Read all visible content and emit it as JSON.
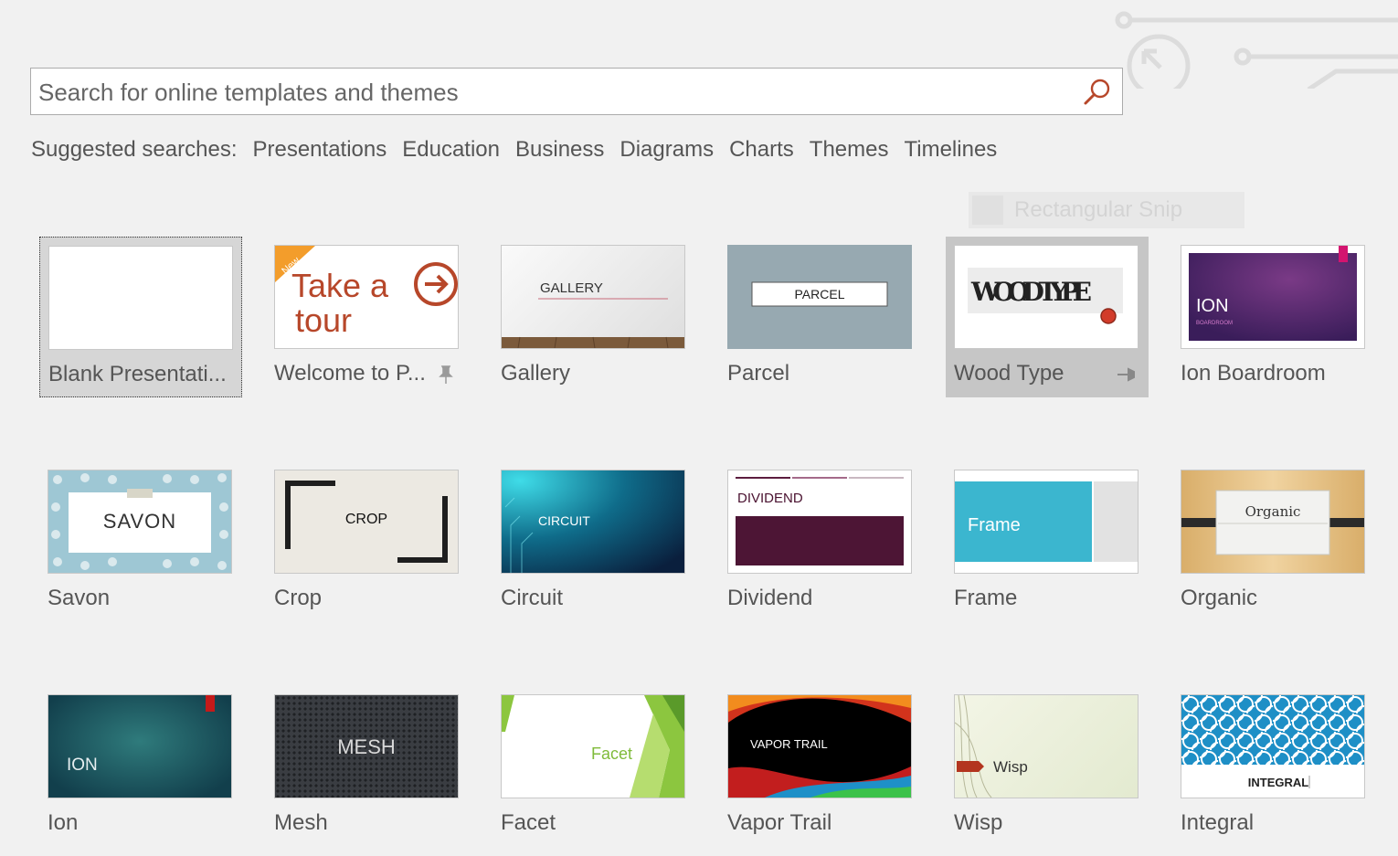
{
  "search": {
    "placeholder": "Search for online templates and themes",
    "value": ""
  },
  "suggested": {
    "label": "Suggested searches:",
    "links": [
      "Presentations",
      "Education",
      "Business",
      "Diagrams",
      "Charts",
      "Themes",
      "Timelines"
    ]
  },
  "overlay": {
    "snip_label": "Rectangular Snip"
  },
  "templates": [
    {
      "name": "Blank Presentati...",
      "thumb_text": ""
    },
    {
      "name": "Welcome to P...",
      "thumb_text": "Take a tour",
      "badge": "New",
      "pin": "pin-icon"
    },
    {
      "name": "Gallery",
      "thumb_text": "GALLERY"
    },
    {
      "name": "Parcel",
      "thumb_text": "PARCEL"
    },
    {
      "name": "Wood Type",
      "thumb_text": "WOOD TYPE",
      "pin": "pinned-icon"
    },
    {
      "name": "Ion Boardroom",
      "thumb_text": "ION",
      "thumb_subtext": "BOARDROOM"
    },
    {
      "name": "Savon",
      "thumb_text": "SAVON"
    },
    {
      "name": "Crop",
      "thumb_text": "CROP"
    },
    {
      "name": "Circuit",
      "thumb_text": "CIRCUIT"
    },
    {
      "name": "Dividend",
      "thumb_text": "DIVIDEND"
    },
    {
      "name": "Frame",
      "thumb_text": "Frame"
    },
    {
      "name": "Organic",
      "thumb_text": "Organic"
    },
    {
      "name": "Ion",
      "thumb_text": "ION"
    },
    {
      "name": "Mesh",
      "thumb_text": "MESH"
    },
    {
      "name": "Facet",
      "thumb_text": "Facet"
    },
    {
      "name": "Vapor Trail",
      "thumb_text": "VAPOR TRAIL"
    },
    {
      "name": "Wisp",
      "thumb_text": "Wisp"
    },
    {
      "name": "Integral",
      "thumb_text": "INTEGRAL"
    }
  ],
  "colors": {
    "accent": "#b7472a",
    "background": "#f1f1f1"
  }
}
